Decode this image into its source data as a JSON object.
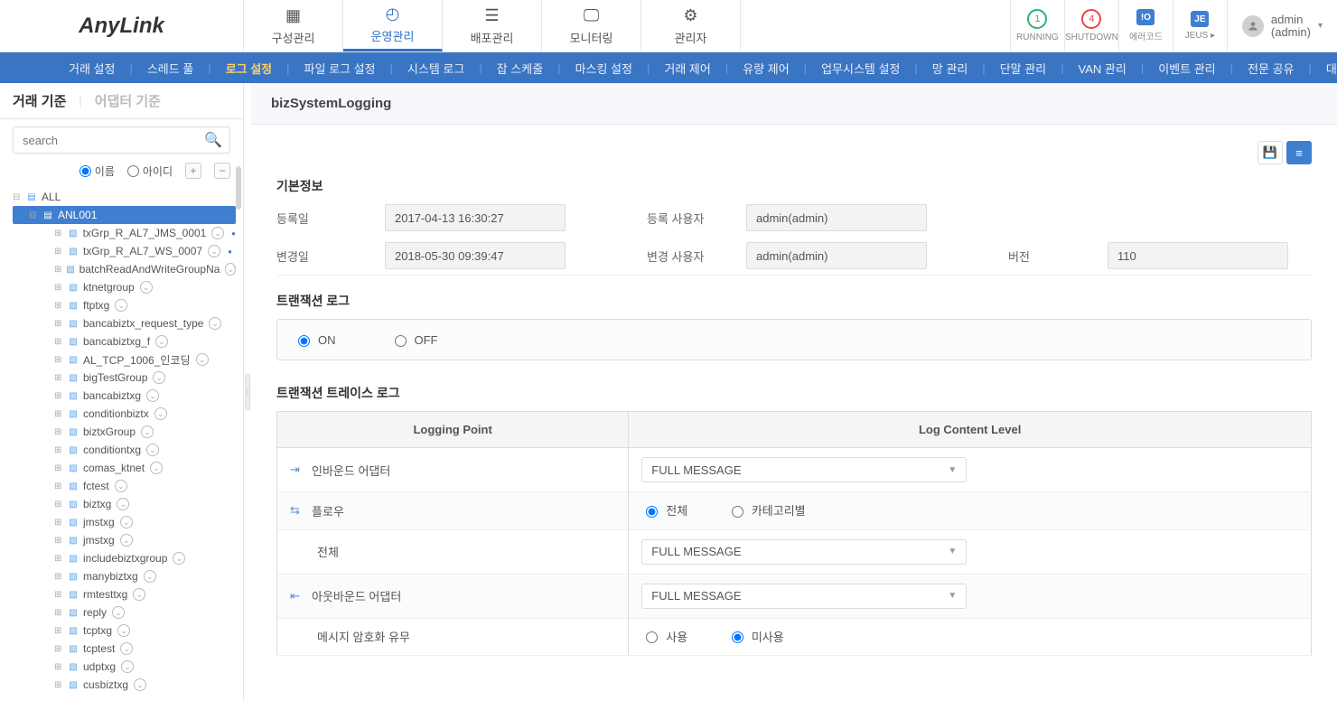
{
  "brand": "AnyLink",
  "mainTabs": [
    "구성관리",
    "운영관리",
    "배포관리",
    "모니터링",
    "관리자"
  ],
  "mainActive": 1,
  "status": {
    "running": {
      "count": "1",
      "label": "RUNNING"
    },
    "shutdown": {
      "count": "4",
      "label": "SHUTDOWN"
    },
    "err": {
      "badge": "!O",
      "label": "에러코드"
    },
    "jeus": {
      "badge": "JE",
      "label": "JEUS"
    }
  },
  "user": {
    "line1": "admin",
    "line2": "(admin)"
  },
  "subnav": [
    "거래 설정",
    "스레드 풀",
    "로그 설정",
    "파일 로그 설정",
    "시스템 로그",
    "잡 스케줄",
    "마스킹 설정",
    "거래 제어",
    "유량 제어",
    "업무시스템 설정",
    "망 관리",
    "단말 관리",
    "VAN 관리",
    "이벤트 관리",
    "전문 공유",
    "대외 연락처"
  ],
  "subActive": 2,
  "side": {
    "tabs": [
      "거래 기준",
      "어댑터 기준"
    ],
    "searchPlaceholder": "search",
    "radioName": "이름",
    "radioId": "아이디",
    "root": "ALL",
    "selected": "ANL001",
    "nodes": [
      "txGrp_R_AL7_JMS_0001",
      "txGrp_R_AL7_WS_0007",
      "batchReadAndWriteGroupNa",
      "ktnetgroup",
      "ftptxg",
      "bancabiztx_request_type",
      "bancabiztxg_f",
      "AL_TCP_1006_인코딩",
      "bigTestGroup",
      "bancabiztxg",
      "conditionbiztx",
      "biztxGroup",
      "conditiontxg",
      "comas_ktnet",
      "fctest",
      "biztxg",
      "jmstxg",
      "jmstxg",
      "includebiztxgroup",
      "manybiztxg",
      "rmtesttxg",
      "reply",
      "tcptxg",
      "tcptest",
      "udptxg",
      "cusbiztxg"
    ]
  },
  "title": "bizSystemLogging",
  "sections": {
    "basic": "기본정보",
    "txlog": "트랜잭션 로그",
    "trace": "트랜잭션 트레이스 로그"
  },
  "form": {
    "regDateLabel": "등록일",
    "regDate": "2017-04-13 16:30:27",
    "regUserLabel": "등록 사용자",
    "regUser": "admin(admin)",
    "modDateLabel": "변경일",
    "modDate": "2018-05-30 09:39:47",
    "modUserLabel": "변경 사용자",
    "modUser": "admin(admin)",
    "versionLabel": "버전",
    "version": "110"
  },
  "txRadio": {
    "on": "ON",
    "off": "OFF"
  },
  "traceTable": {
    "h1": "Logging Point",
    "h2": "Log Content Level",
    "rows": {
      "inbound": "인바운드 어댑터",
      "flow": "플로우",
      "flowAll": "전체",
      "flowAllOpt": "전체",
      "flowCat": "카테고리별",
      "outbound": "아웃바운드 어댑터",
      "enc": "메시지 암호화 유무",
      "encUse": "사용",
      "encNo": "미사용",
      "selectVal": "FULL MESSAGE"
    }
  }
}
